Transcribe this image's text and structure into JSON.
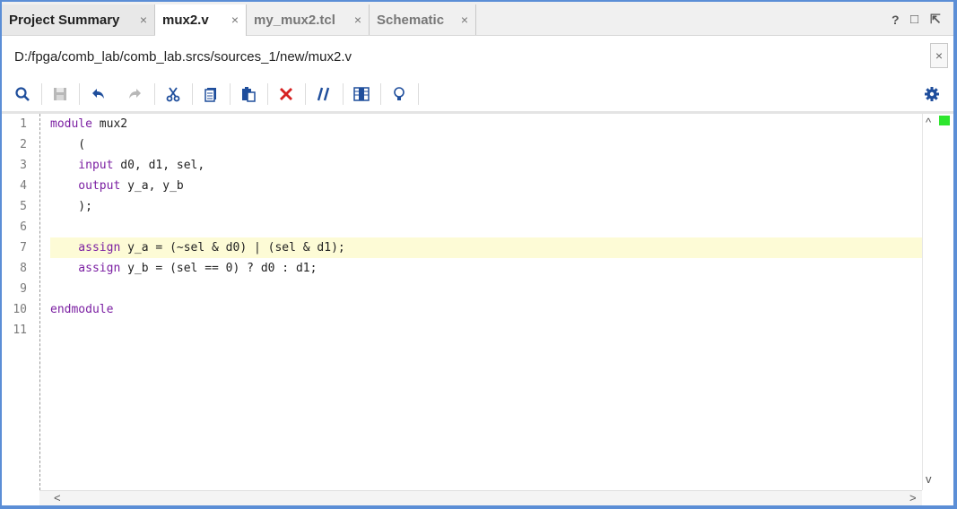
{
  "tabs": [
    {
      "label": "Project Summary",
      "close": "×"
    },
    {
      "label": "mux2.v",
      "close": "×"
    },
    {
      "label": "my_mux2.tcl",
      "close": "×"
    },
    {
      "label": "Schematic",
      "close": "×"
    }
  ],
  "window_controls": {
    "help": "?",
    "restore": "□",
    "float": "⇱"
  },
  "path": {
    "text": "D:/fpga/comb_lab/comb_lab.srcs/sources_1/new/mux2.v",
    "close": "×"
  },
  "toolbar": [
    {
      "icon": "search-icon"
    },
    {
      "icon": "save-icon"
    },
    {
      "icon": "undo-icon"
    },
    {
      "icon": "redo-icon"
    },
    {
      "icon": "cut-icon"
    },
    {
      "icon": "copy-icon"
    },
    {
      "icon": "paste-icon"
    },
    {
      "icon": "delete-icon",
      "color": "#d62020"
    },
    {
      "icon": "comment-icon"
    },
    {
      "icon": "column-select-icon"
    },
    {
      "icon": "lightbulb-icon"
    },
    {
      "icon": "settings-gear-icon",
      "color": "#1f4e9c"
    }
  ],
  "editor": {
    "highlighted_line": 7,
    "line_numbers": [
      "1",
      "2",
      "3",
      "4",
      "5",
      "6",
      "7",
      "8",
      "9",
      "10",
      "11"
    ],
    "lines": [
      {
        "kw": "module",
        "rest": " mux2"
      },
      {
        "kw": "",
        "rest": "    ("
      },
      {
        "kw": "    input",
        "rest": " d0, d1, sel,"
      },
      {
        "kw": "    output",
        "rest": " y_a, y_b"
      },
      {
        "kw": "",
        "rest": "    );"
      },
      {
        "kw": "",
        "rest": ""
      },
      {
        "kw": "    assign",
        "rest": " y_a = (~sel & d0) | (sel & d1);"
      },
      {
        "kw": "    assign",
        "rest": " y_b = (sel == 0) ? d0 : d1;"
      },
      {
        "kw": "",
        "rest": ""
      },
      {
        "kw": "endmodule",
        "rest": ""
      },
      {
        "kw": "",
        "rest": ""
      }
    ]
  },
  "scroll": {
    "up": "^",
    "down": "v",
    "left": "<",
    "right": ">"
  },
  "colors": {
    "keyword": "#7b1fa2",
    "highlight": "#fdfbd6",
    "status_marker": "#2ee62e",
    "window_border": "#5b8ed6"
  }
}
